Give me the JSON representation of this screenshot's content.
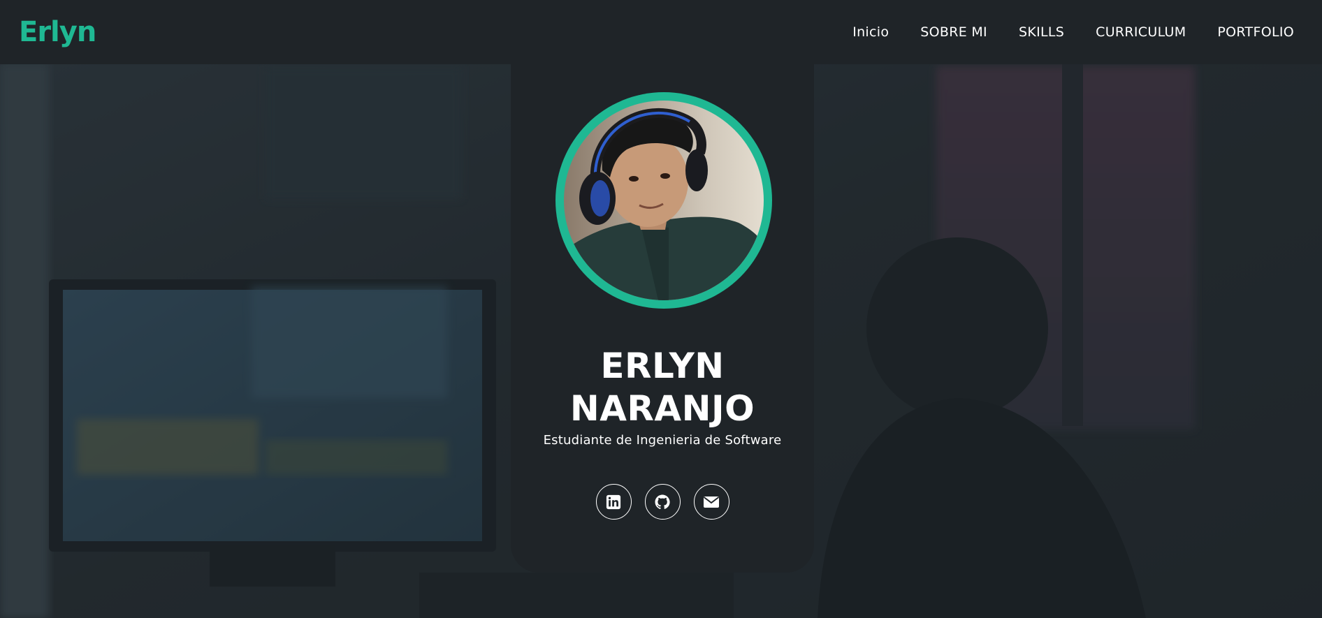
{
  "brand": {
    "logo_text": "Erlyn",
    "accent_color": "#1fb893"
  },
  "nav": {
    "items": [
      {
        "label": "Inicio"
      },
      {
        "label": "SOBRE MI"
      },
      {
        "label": "SKILLS"
      },
      {
        "label": "CURRICULUM"
      },
      {
        "label": "PORTFOLIO"
      }
    ]
  },
  "profile": {
    "first_name": "ERLYN",
    "last_name": "NARANJO",
    "role": "Estudiante de Ingenieria de Software",
    "socials": [
      {
        "icon": "linkedin-icon"
      },
      {
        "icon": "github-icon"
      },
      {
        "icon": "email-icon"
      }
    ]
  },
  "colors": {
    "header_bg": "#1f2428",
    "card_bg": "#1f2428",
    "text": "#ffffff"
  }
}
